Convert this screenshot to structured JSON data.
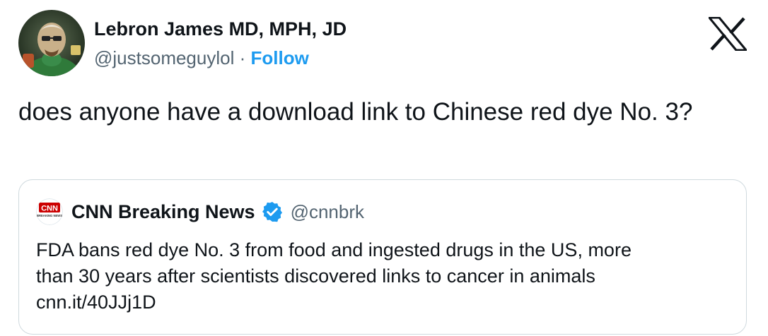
{
  "author": {
    "display_name": "Lebron James MD, MPH, JD",
    "handle": "@justsomeguylol",
    "separator": " · ",
    "follow_label": "Follow",
    "avatar": "avatar-image"
  },
  "header": {
    "logo": "x-logo-icon"
  },
  "tweet": {
    "text": "does anyone have a download link to Chinese red dye No. 3?"
  },
  "quote": {
    "logo_text": "CNN",
    "logo_subtext": "BREAKING NEWS",
    "display_name": "CNN Breaking News",
    "verified_icon": "verified-badge-icon",
    "handle": "@cnnbrk",
    "lines": [
      "FDA bans red dye No. 3 from food and ingested drugs in the US, more",
      "than 30 years after scientists discovered links to cancer in animals",
      "cnn.it/40JJj1D"
    ]
  },
  "colors": {
    "accent": "#1d9bf0",
    "text": "#0f1419",
    "secondary": "#536471",
    "border": "#cfd9de",
    "cnn_red": "#cc0000"
  }
}
